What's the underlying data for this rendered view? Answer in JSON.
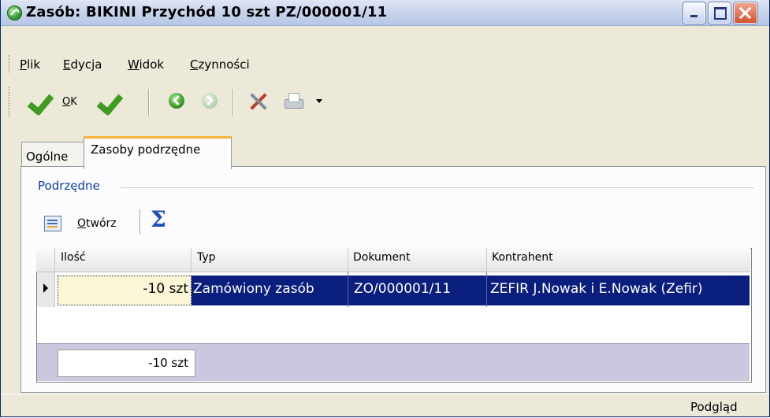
{
  "window": {
    "title": "Zasób: BIKINI Przychód 10 szt PZ/000001/11"
  },
  "menu": {
    "items": [
      {
        "label": "Plik",
        "accel": "P",
        "rest": "lik"
      },
      {
        "label": "Edycja",
        "accel": "E",
        "rest": "dycja"
      },
      {
        "label": "Widok",
        "accel": "W",
        "rest": "idok"
      },
      {
        "label": "Czynności",
        "accel": "C",
        "rest": "zynności"
      }
    ]
  },
  "toolbar": {
    "ok_label": "OK",
    "ok_accel": "O",
    "ok_rest": "K"
  },
  "tabs": [
    {
      "label": "Ogólne"
    },
    {
      "label": "Zasoby podrzędne"
    }
  ],
  "group": {
    "legend": "Podrzędne"
  },
  "subtoolbar": {
    "open_label": "Otwórz",
    "open_accel": "O",
    "open_rest": "twórz"
  },
  "grid": {
    "columns": [
      "Ilość",
      "Typ",
      "Dokument",
      "Kontrahent"
    ],
    "rows": [
      {
        "ilosc": "-10 szt",
        "typ": "Zamówiony zasób",
        "dokument": "ZO/000001/11",
        "kontrahent": "ZEFIR J.Nowak i E.Nowak (Zefir)"
      }
    ],
    "footer_total": "-10 szt"
  },
  "status": {
    "text": "Podgląd"
  }
}
